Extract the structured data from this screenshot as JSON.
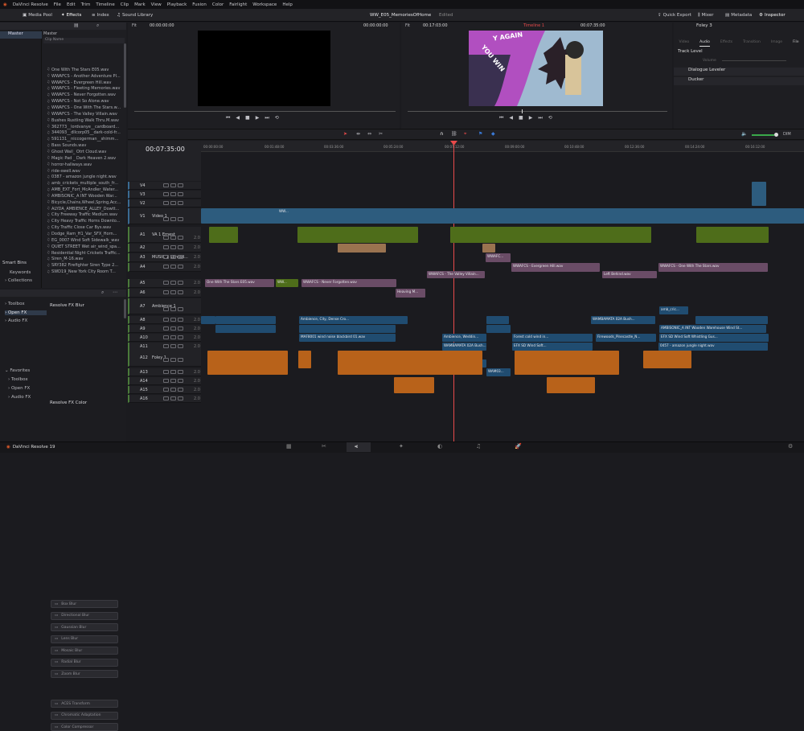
{
  "menubar": {
    "app": "DaVinci Resolve",
    "items": [
      "File",
      "Edit",
      "Trim",
      "Timeline",
      "Clip",
      "Mark",
      "View",
      "Playback",
      "Fusion",
      "Color",
      "Fairlight",
      "Workspace",
      "Help"
    ]
  },
  "topbar": {
    "media_pool": "Media Pool",
    "effects": "Effects",
    "index": "Index",
    "sound_library": "Sound Library",
    "project_title": "WW_E05_MemoriesOfHome",
    "edited": "Edited",
    "quick_export": "Quick Export",
    "mixer": "Mixer",
    "metadata": "Metadata",
    "inspector": "Inspector"
  },
  "bins": {
    "master_label": "Master",
    "column_master": "Master",
    "clip_name_header": "Clip Name",
    "smart_bins": "Smart Bins",
    "keywords": "Keywords",
    "collections": "Collections"
  },
  "clips": [
    "One With The Stars E05.wav",
    "WWAFCS - Another Adventure Pl...",
    "WWAFCS - Evergreen Hill.wav",
    "WWAFCS - Fleeting Memories.wav",
    "WWAFCS - Never Forgotten.wav",
    "WWAFCS - Not So Alone.wav",
    "WWAFCS - One With The Stars.w...",
    "WWAFCS - The Valley Villain.wav",
    "Bushes Rustling Walk Thru.M.wav",
    "362773__lordvanye__cardboard...",
    "344093__dllcorp05__dark-cold-fr...",
    "591131__niccogerman__shimm...",
    "Bass Sounds.wav",
    "Ghost Wail_ Otrt Cloud.wav",
    "Magic Pad _ Dark Heaven 2.wav",
    "horror-hallways.wav",
    "ride-swell.wav",
    "0387 - amazon jungle night.wav",
    "amb_crickets_multiple_south_fr...",
    "AMB_EXT_Fort_McAndler_Water...",
    "AMBISONIC_A INT Wooden War...",
    "Bicycle,Chains,Wheel,Spring,Acc...",
    "ALYDA_AMBIENCE_ALLEY_Dowtt...",
    "City Freeway Traffic Medium.wav",
    "City Heavy Traffic Horns Downto...",
    "City Traffic Close Car Bys.wav",
    "Dodge_Ram_H1_Var_SFX_Horn...",
    "EG_0007 Wind Soft Sidewalk_wav",
    "QUIET STREET Wet air_wind_spa...",
    "Residential Night Crickets Traffic...",
    "Siren_M-16.wav",
    "SRY382 Firefighter Siren Type 2...",
    "SWD19_New York City Room T..."
  ],
  "effects_panel": {
    "toolbox": "Toolbox",
    "open_fx": "Open FX",
    "audio_fx": "Audio FX",
    "favorites": "Favorites",
    "fav_toolbox": "Toolbox",
    "fav_open_fx": "Open FX",
    "fav_audio_fx": "Audio FX",
    "blur_header": "Resolve FX Blur",
    "blur_items": [
      "Box Blur",
      "Directional Blur",
      "Gaussian Blur",
      "Lens Blur",
      "Mosaic Blur",
      "Radial Blur",
      "Zoom Blur"
    ],
    "color_header": "Resolve FX Color",
    "color_items": [
      "ACES Transform",
      "Chromatic Adaptation",
      "Color Compressor"
    ]
  },
  "source_viewer": {
    "fit": "Fit",
    "tc_left": "00:00:00:00",
    "tc_right": "00:00:00:00"
  },
  "timeline_viewer": {
    "fit": "Fit",
    "tc_left": "00:17:03:00",
    "timeline_name": "Timeline 1",
    "tc_right": "00:07:35:00",
    "graphic_text1": "Y AGAIN",
    "graphic_text2": "YOU WIN"
  },
  "inspector": {
    "title": "Foley 3",
    "tabs": [
      "Video",
      "Audio",
      "Effects",
      "Transition",
      "Image",
      "File"
    ],
    "track_level": "Track Level",
    "volume": "Volume",
    "dialogue_leveler": "Dialogue Leveler",
    "ducker": "Ducker"
  },
  "timeline": {
    "current_tc": "00:07:35:00",
    "ruler": [
      "00:00:00:00",
      "00:01:48:00",
      "00:03:36:00",
      "00:05:24:00",
      "00:07:12:00",
      "00:09:00:00",
      "00:10:48:00",
      "00:12:36:00",
      "00:14:24:00",
      "00:16:12:00"
    ],
    "dim": "DIM",
    "tracks": [
      {
        "id": "V4",
        "name": "",
        "level": ""
      },
      {
        "id": "V3",
        "name": "",
        "level": ""
      },
      {
        "id": "V2",
        "name": "",
        "level": ""
      },
      {
        "id": "V1",
        "name": "Video 1",
        "level": ""
      },
      {
        "id": "A1",
        "name": "VA 1 Ernest",
        "level": "2.0"
      },
      {
        "id": "A2",
        "name": "",
        "level": "2.0"
      },
      {
        "id": "A3",
        "name": "MUSIC 1 Spread...",
        "level": "2.0"
      },
      {
        "id": "A4",
        "name": "",
        "level": "2.0"
      },
      {
        "id": "A5",
        "name": "",
        "level": "2.0"
      },
      {
        "id": "A6",
        "name": "",
        "level": "2.0"
      },
      {
        "id": "A7",
        "name": "Ambience 1",
        "level": ""
      },
      {
        "id": "A8",
        "name": "",
        "level": "2.0"
      },
      {
        "id": "A9",
        "name": "",
        "level": "2.0"
      },
      {
        "id": "A10",
        "name": "",
        "level": "2.0"
      },
      {
        "id": "A11",
        "name": "",
        "level": "2.0"
      },
      {
        "id": "A12",
        "name": "Foley 1",
        "level": ""
      },
      {
        "id": "A13",
        "name": "",
        "level": "2.0"
      },
      {
        "id": "A14",
        "name": "",
        "level": "2.0"
      },
      {
        "id": "A15",
        "name": "",
        "level": "2.0"
      },
      {
        "id": "A16",
        "name": "",
        "level": "2.0"
      }
    ],
    "clip_labels": {
      "evergreen1": "WWAFC...",
      "evergreen2": "WWAFCS - Evergreen Hill.wav",
      "left_behind": "Left Behind.wav",
      "one_stars": "WWAFCS - One With The Stars.wav",
      "valley": "WWAFCS - The Valley Villain...",
      "one_stars_e05": "One With The Stars E05.wav",
      "ww": "WW...",
      "never_forgotten": "WWAFCS - Never Forgotten.wav",
      "heaving": "Heaving M...",
      "amb_cric": "amb_cric...",
      "ambience_city": "Ambience, City, Dense Cro...",
      "wam_ext": "WAMBAMATA 02A Bush...",
      "maf_wind": "MAF8001 wind noise blackbird 01.wav",
      "forest_wind": "Forest cold wind in...",
      "firewoods": "Firewoods_Pinecastle_N...",
      "ambisonic": "AMBISONIC_A INT Wooden Warehouse Wind St...",
      "efx_wind": "EFX SD Wind Soft Whistling Gus...",
      "efx_wind2": "EFX SD Wind Soft W...",
      "ambience_wedding": "Ambience, Weddin...",
      "wam2": "WAMBAMATA 02A Bush...",
      "efx_sd": "EFX SD Wind Soft...",
      "jungle": "0457 - amazon jungle night.wav",
      "amb_int": "AMB_INT_Party_St...",
      "wam3": "WAM03..."
    },
    "sample_clip": "WW..."
  },
  "footer": {
    "app_version": "DaVinci Resolve 19"
  }
}
